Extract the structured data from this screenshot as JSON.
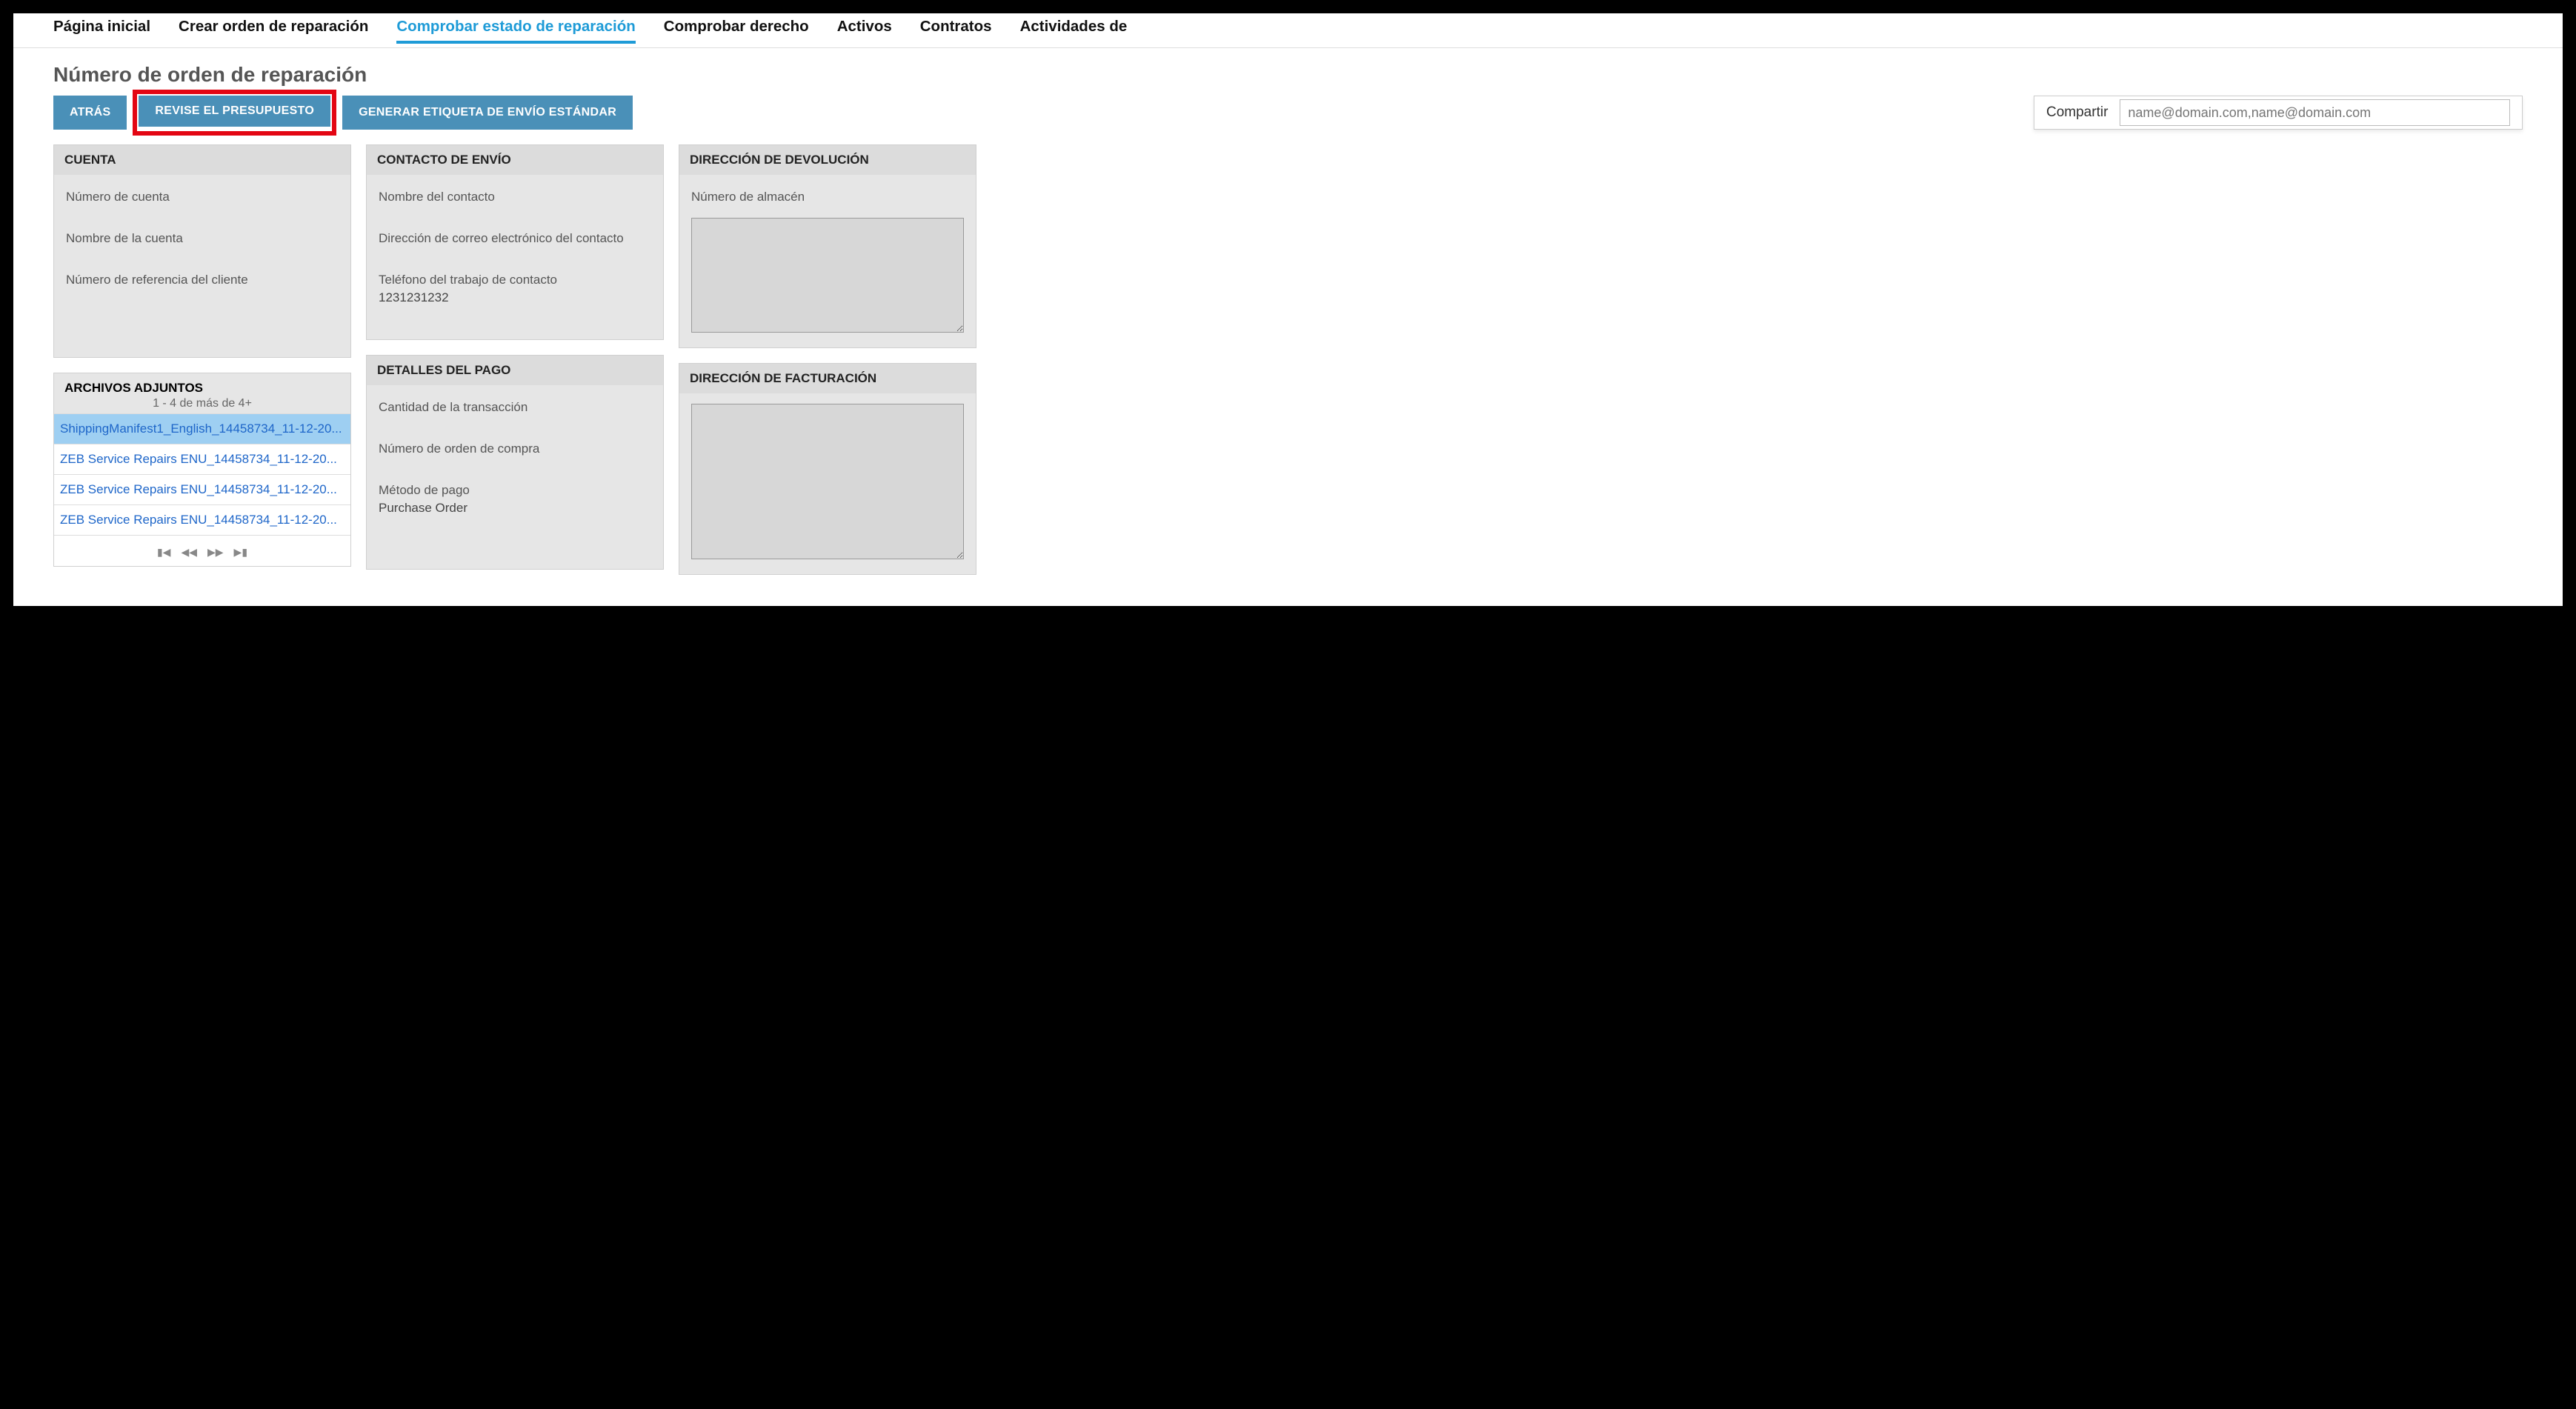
{
  "tabs": {
    "home": "Página inicial",
    "create": "Crear orden de reparación",
    "status": "Comprobar estado de reparación",
    "entitlement": "Comprobar derecho",
    "assets": "Activos",
    "contracts": "Contratos",
    "activities": "Actividades de"
  },
  "page": {
    "title": "Número de orden de reparación"
  },
  "actions": {
    "back": "ATRÁS",
    "review_quote": "REVISE EL PRESUPUESTO",
    "gen_label": "GENERAR ETIQUETA DE ENVÍO ESTÁNDAR"
  },
  "share": {
    "label": "Compartir",
    "placeholder": "name@domain.com,name@domain.com"
  },
  "account": {
    "header": "CUENTA",
    "number_label": "Número de cuenta",
    "name_label": "Nombre de la cuenta",
    "ref_label": "Número de referencia del cliente"
  },
  "ship_contact": {
    "header": "CONTACTO DE ENVÍO",
    "name_label": "Nombre del contacto",
    "email_label": "Dirección de correo electrónico del contacto",
    "phone_label": "Teléfono del trabajo de contacto",
    "phone_value": "1231231232"
  },
  "return_addr": {
    "header": "DIRECCIÓN DE DEVOLUCIÓN",
    "warehouse_label": "Número de almacén"
  },
  "attachments": {
    "header": "ARCHIVOS ADJUNTOS",
    "range": "1 - 4 de más de 4+",
    "items": [
      "ShippingManifest1_English_14458734_11-12-20...",
      "ZEB Service Repairs ENU_14458734_11-12-20...",
      "ZEB Service Repairs ENU_14458734_11-12-20...",
      "ZEB Service Repairs ENU_14458734_11-12-20..."
    ]
  },
  "payment": {
    "header": "DETALLES DEL PAGO",
    "amount_label": "Cantidad de la transacción",
    "po_label": "Número de orden de compra",
    "method_label": "Método de pago",
    "method_value": "Purchase Order"
  },
  "billing": {
    "header": "DIRECCIÓN DE FACTURACIÓN"
  },
  "pager": {
    "first": "⏮",
    "prev": "◀◀",
    "next": "▶▶",
    "last": "⏭"
  }
}
